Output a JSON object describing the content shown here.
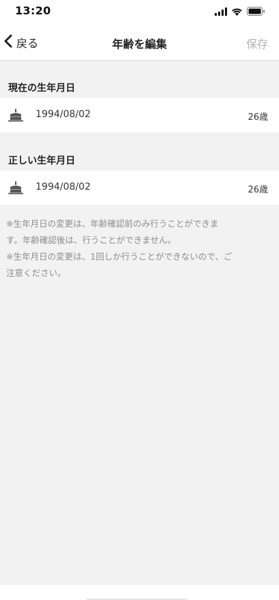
{
  "status_bar": {
    "time": "13:20",
    "icons": [
      "signal-icon",
      "wifi-icon",
      "battery-icon"
    ]
  },
  "nav": {
    "back_label": "戻る",
    "title": "年齢を編集",
    "save_label": "保存"
  },
  "current": {
    "header": "現在の生年月日",
    "date": "1994/08/02",
    "age": "26歳",
    "icon": "birthday-cake-icon"
  },
  "correct": {
    "header": "正しい生年月日",
    "date": "1994/08/02",
    "age": "26歳",
    "icon": "birthday-cake-icon"
  },
  "notes": {
    "line1": "※生年月日の変更は、年齢確認前のみ行うことができま",
    "line2": "す。年齢確認後は、行うことができません。",
    "line3": "※生年月日の変更は、1回しか行うことができないので、ご",
    "line4": "注意ください。"
  },
  "colors": {
    "background": "#f2f2f2",
    "card": "#ffffff",
    "save_disabled": "#b3b3b3",
    "note_text": "#8c8c8c"
  }
}
